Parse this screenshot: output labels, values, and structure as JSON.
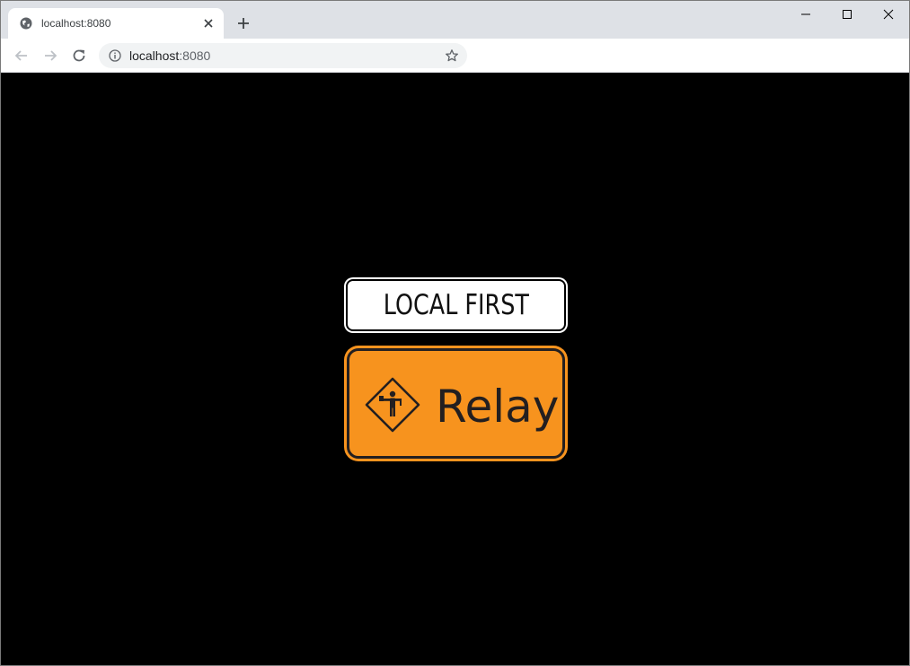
{
  "browser": {
    "tab": {
      "title": "localhost:8080",
      "favicon": "globe-icon",
      "close_icon": "close-icon"
    },
    "new_tab_icon": "plus-icon",
    "window_controls": [
      "minimize-icon",
      "maximize-icon",
      "close-icon"
    ],
    "toolbar": {
      "back_icon": "arrow-left-icon",
      "forward_icon": "arrow-right-icon",
      "reload_icon": "reload-icon",
      "site_info_icon": "info-icon",
      "url_host": "localhost",
      "url_port": ":8080",
      "bookmark_icon": "star-icon"
    }
  },
  "page": {
    "background": "#000000",
    "plaque": {
      "text": "LOCAL FIRST",
      "background": "#ffffff",
      "border": "#000000"
    },
    "sign": {
      "symbol": "flagger-diamond-icon",
      "text": "Relay",
      "background": "#f7931e",
      "border": "#231f20"
    }
  }
}
